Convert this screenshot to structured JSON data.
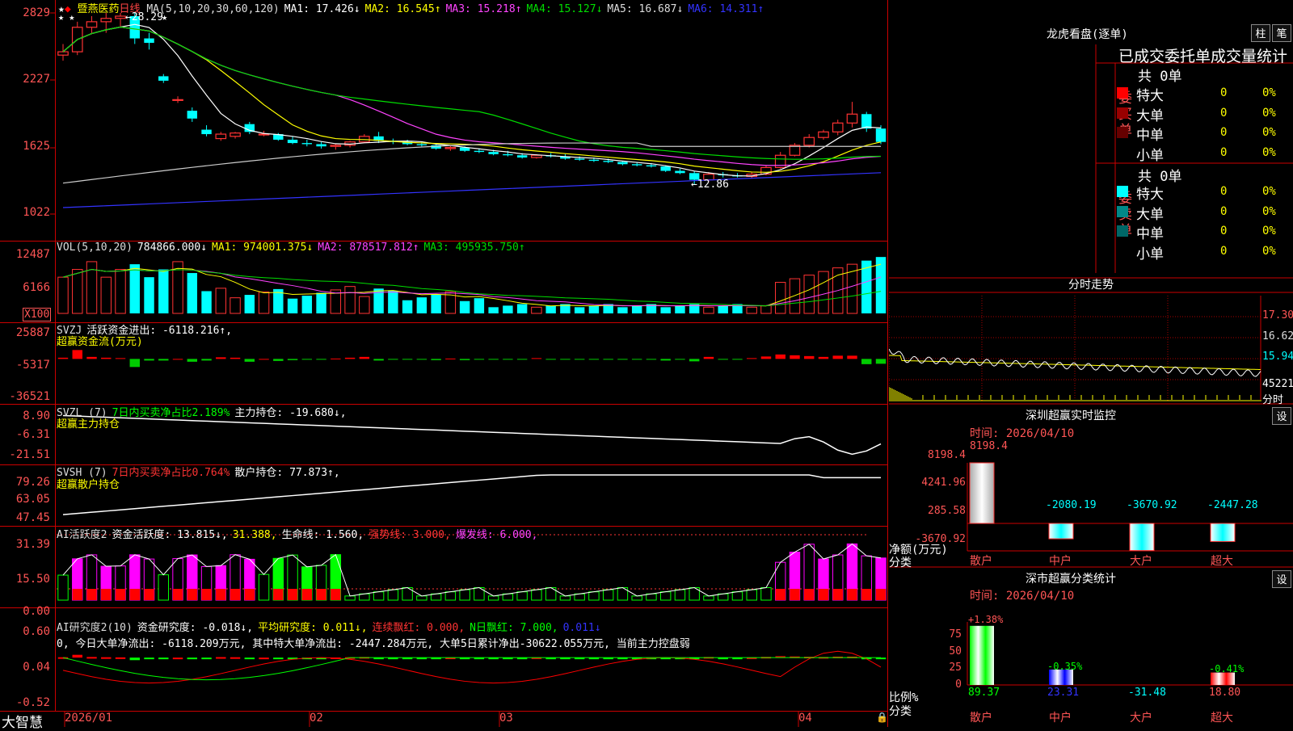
{
  "app": {
    "brand": "大智慧",
    "stock_name": "暨燕医药",
    "period": "日线"
  },
  "main_panel": {
    "y_ticks": [
      "2829",
      "2227",
      "1625",
      "1022"
    ],
    "legend": [
      {
        "text": "MA(5,10,20,30,60,120)",
        "color": "#dddddd"
      },
      {
        "text": "MA1: 17.426↓",
        "color": "#ffffff"
      },
      {
        "text": "MA2: 16.545↑",
        "color": "#ffff00"
      },
      {
        "text": "MA3: 15.218↑",
        "color": "#ff44ff"
      },
      {
        "text": "MA4: 15.127↓",
        "color": "#00dd00"
      },
      {
        "text": "MA5: 16.687↓",
        "color": "#dddddd"
      },
      {
        "text": "MA6: 14.311↑",
        "color": "#3333ff"
      }
    ],
    "high_label": "28.29",
    "low_label": "12.86",
    "marks": [
      "★",
      "★",
      "★",
      "★",
      "★"
    ]
  },
  "vol_panel": {
    "y_ticks": [
      "12487",
      "6166"
    ],
    "unit": "X100",
    "legend": [
      {
        "text": "VOL(5,10,20)",
        "color": "#dddddd"
      },
      {
        "text": "784866.000↓",
        "color": "#ffffff"
      },
      {
        "text": "MA1: 974001.375↓",
        "color": "#ffff00"
      },
      {
        "text": "MA2: 878517.812↑",
        "color": "#ff44ff"
      },
      {
        "text": "MA3: 495935.750↑",
        "color": "#00dd00"
      }
    ]
  },
  "svzj_panel": {
    "y_ticks": [
      "25887",
      "-5317",
      "-36521"
    ],
    "legend": [
      {
        "text": "SVZJ",
        "color": "#dddddd"
      },
      {
        "text": "活跃资金进出: -6118.216↑,",
        "color": "#ffffff"
      }
    ],
    "subtitle": "超赢资金流(万元)"
  },
  "svzl_panel": {
    "y_ticks": [
      "8.90",
      "-6.31",
      "-21.51"
    ],
    "legend": [
      {
        "text": "SVZL (7)",
        "color": "#dddddd"
      },
      {
        "text": "7日内买卖净占比2.189%",
        "color": "#00ff00"
      },
      {
        "text": "主力持仓: -19.680↓,",
        "color": "#ffffff"
      }
    ],
    "subtitle": "超赢主力持仓"
  },
  "svsh_panel": {
    "y_ticks": [
      "79.26",
      "63.05",
      "47.45"
    ],
    "legend": [
      {
        "text": "SVSH (7)",
        "color": "#dddddd"
      },
      {
        "text": "7日内买卖净占比0.764%",
        "color": "#ff3333"
      },
      {
        "text": "散户持仓: 77.873↑,",
        "color": "#ffffff"
      }
    ],
    "subtitle": "超赢散户持仓"
  },
  "ai_active_panel": {
    "y_ticks": [
      "31.39",
      "15.50",
      "0.00"
    ],
    "legend": [
      {
        "text": "AI活跃度2",
        "color": "#dddddd"
      },
      {
        "text": "资金活跃度: 13.815↓,",
        "color": "#ffffff"
      },
      {
        "text": "31.388,",
        "color": "#ffff00"
      },
      {
        "text": "生命线: 1.560,",
        "color": "#ffffff"
      },
      {
        "text": "强势线: 3.000,",
        "color": "#ff3333"
      },
      {
        "text": "爆发线: 6.000,",
        "color": "#ff44ff"
      }
    ]
  },
  "ai_research_panel": {
    "y_ticks": [
      "0.60",
      "0.04",
      "-0.52"
    ],
    "legend": [
      {
        "text": "AI研究度2(10)",
        "color": "#dddddd"
      },
      {
        "text": "资金研究度: -0.018↓,",
        "color": "#ffffff"
      },
      {
        "text": "平均研究度: 0.011↓,",
        "color": "#ffff00"
      },
      {
        "text": "连续飘红: 0.000,",
        "color": "#ff3333"
      },
      {
        "text": "N日飘红: 7.000,",
        "color": "#00ff00"
      },
      {
        "text": "0.011↓",
        "color": "#3333ff"
      }
    ],
    "summary": "0, 今日大单净流出: -6118.209万元, 其中特大单净流出: -2447.284万元, 大单5日累计净出-30622.055万元, 当前主力控盘弱"
  },
  "x_axis": {
    "labels": [
      "2026/01",
      "02",
      "03",
      "04"
    ]
  },
  "right_panel": {
    "dragon_title": "龙虎看盘(逐单)",
    "btn_bar": "柱",
    "btn_pen": "笔",
    "stats_title": "已成交委托单成交量统计",
    "buy_side": {
      "label": "委买单",
      "total": "共 0单",
      "rows": [
        {
          "name": "特大",
          "count": "0",
          "pct": "0%",
          "color": "#ff0000"
        },
        {
          "name": "大单",
          "count": "0",
          "pct": "0%",
          "color": "#990000"
        },
        {
          "name": "中单",
          "count": "0",
          "pct": "0%",
          "color": "#660000"
        },
        {
          "name": "小单",
          "count": "0",
          "pct": "0%",
          "color": ""
        }
      ]
    },
    "sell_side": {
      "label": "委卖单",
      "total": "共 0单",
      "rows": [
        {
          "name": "特大",
          "count": "0",
          "pct": "0%",
          "color": "#00ffff"
        },
        {
          "name": "大单",
          "count": "0",
          "pct": "0%",
          "color": "#008888"
        },
        {
          "name": "中单",
          "count": "0",
          "pct": "0%",
          "color": "#006666"
        },
        {
          "name": "小单",
          "count": "0",
          "pct": "0%",
          "color": ""
        }
      ]
    },
    "intraday": {
      "title": "分时走势",
      "price_ticks": [
        "17.30",
        "16.62",
        "15.94"
      ],
      "vol_tick": "45221",
      "vol_label": "分时"
    },
    "monitor": {
      "title": "深圳超赢实时监控",
      "settings": "设",
      "time": "时间: 2026/04/10",
      "y_ticks": [
        "8198.4",
        "4241.96",
        "285.58",
        "-3670.92"
      ],
      "top_value": "8198.4",
      "ylabel": "净额(万元)",
      "xlabel": "分类",
      "categories": [
        "散户",
        "中户",
        "大户",
        "超大"
      ],
      "values": [
        8198.4,
        -2080.19,
        -3670.92,
        -2447.28
      ],
      "value_labels": [
        "",
        "-2080.19",
        "-3670.92",
        "-2447.28"
      ]
    },
    "classify": {
      "title": "深市超赢分类统计",
      "settings": "设",
      "time": "时间: 2026/04/10",
      "y_ticks": [
        "75",
        "50",
        "25",
        "0"
      ],
      "ylabel": "比例%",
      "xlabel": "分类",
      "categories": [
        "散户",
        "中户",
        "大户",
        "超大"
      ],
      "pct_labels": [
        "+1.38%",
        "-0.35%",
        "",
        "-0.41%"
      ],
      "values": [
        89.37,
        23.31,
        -31.48,
        18.8
      ],
      "value_labels": [
        "89.37",
        "23.31",
        "-31.48",
        "18.80"
      ]
    }
  },
  "chart_data": [
    {
      "type": "candlestick",
      "title": "暨燕医药 日线",
      "ylim": [
        10.22,
        28.29
      ],
      "ohlc": [
        [
          24.5,
          25.5,
          24.0,
          24.8
        ],
        [
          24.8,
          27.5,
          24.5,
          27.0
        ],
        [
          27.0,
          28.0,
          26.5,
          27.5
        ],
        [
          27.5,
          28.29,
          26.5,
          27.8
        ],
        [
          27.8,
          28.29,
          27.0,
          28.0
        ],
        [
          28.0,
          28.29,
          25.5,
          26.0
        ],
        [
          26.0,
          26.5,
          25.0,
          25.6
        ],
        [
          22.6,
          22.8,
          22.0,
          22.2
        ],
        [
          20.5,
          20.8,
          20.2,
          20.5
        ],
        [
          19.5,
          19.8,
          18.5,
          18.8
        ],
        [
          17.8,
          18.2,
          17.2,
          17.4
        ],
        [
          17.0,
          17.6,
          16.8,
          17.4
        ],
        [
          17.2,
          17.6,
          17.0,
          17.5
        ],
        [
          18.3,
          18.5,
          17.4,
          17.6
        ],
        [
          17.4,
          17.7,
          17.2,
          17.4
        ],
        [
          17.4,
          17.5,
          16.8,
          16.9
        ],
        [
          16.9,
          17.2,
          16.5,
          16.6
        ],
        [
          16.6,
          16.9,
          16.3,
          16.5
        ],
        [
          16.5,
          16.7,
          16.1,
          16.3
        ],
        [
          16.3,
          16.5,
          16.0,
          16.4
        ],
        [
          16.4,
          16.8,
          16.2,
          16.7
        ],
        [
          16.7,
          17.4,
          16.6,
          17.2
        ],
        [
          17.2,
          17.6,
          16.6,
          16.8
        ],
        [
          16.8,
          17.0,
          16.5,
          16.7
        ],
        [
          16.7,
          16.9,
          16.4,
          16.5
        ],
        [
          16.5,
          16.7,
          16.3,
          16.4
        ],
        [
          16.4,
          16.6,
          16.0,
          16.1
        ],
        [
          16.1,
          16.4,
          15.9,
          16.2
        ],
        [
          16.2,
          16.3,
          15.8,
          15.9
        ],
        [
          15.9,
          16.1,
          15.7,
          15.8
        ],
        [
          15.8,
          16.0,
          15.5,
          15.6
        ],
        [
          15.6,
          15.9,
          15.4,
          15.5
        ],
        [
          15.5,
          15.7,
          15.2,
          15.3
        ],
        [
          15.3,
          15.6,
          15.2,
          15.5
        ],
        [
          15.5,
          15.7,
          15.3,
          15.4
        ],
        [
          15.4,
          15.6,
          15.1,
          15.2
        ],
        [
          15.2,
          15.4,
          15.0,
          15.1
        ],
        [
          15.1,
          15.3,
          14.9,
          15.0
        ],
        [
          15.0,
          15.2,
          14.8,
          14.9
        ],
        [
          14.9,
          15.0,
          14.6,
          14.7
        ],
        [
          14.7,
          14.9,
          14.5,
          14.6
        ],
        [
          14.6,
          14.8,
          14.4,
          14.5
        ],
        [
          14.5,
          14.6,
          14.0,
          14.1
        ],
        [
          14.1,
          14.3,
          13.8,
          13.9
        ],
        [
          13.9,
          14.1,
          12.86,
          13.3
        ],
        [
          13.3,
          14.0,
          13.1,
          13.8
        ],
        [
          13.8,
          14.0,
          13.5,
          13.7
        ],
        [
          13.7,
          13.9,
          13.5,
          13.6
        ],
        [
          13.6,
          14.0,
          13.4,
          13.8
        ],
        [
          13.8,
          14.6,
          13.7,
          14.4
        ],
        [
          14.4,
          15.8,
          14.3,
          15.5
        ],
        [
          15.5,
          16.6,
          15.4,
          16.4
        ],
        [
          16.4,
          17.4,
          16.2,
          17.1
        ],
        [
          17.1,
          17.8,
          16.9,
          17.6
        ],
        [
          17.6,
          18.7,
          17.3,
          18.4
        ],
        [
          18.4,
          20.3,
          18.0,
          19.2
        ],
        [
          19.2,
          19.4,
          17.6,
          17.9
        ],
        [
          17.9,
          18.2,
          16.5,
          16.7
        ]
      ]
    }
  ]
}
